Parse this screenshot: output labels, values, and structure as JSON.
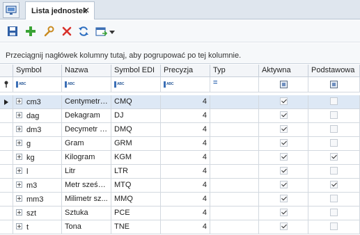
{
  "tab": {
    "title": "Lista jednostek",
    "close_glyph": "✕"
  },
  "toolbar": {
    "icons": [
      "save-icon",
      "add-icon",
      "edit-icon",
      "delete-icon",
      "refresh-icon",
      "export-icon",
      "chevron-down-icon"
    ]
  },
  "group_panel": {
    "text": "Przeciągnij nagłówek kolumny tutaj, aby pogrupować po tej kolumnie."
  },
  "grid": {
    "columns": [
      "Symbol",
      "Nazwa",
      "Symbol EDI",
      "Precyzja",
      "Typ",
      "Aktywna",
      "Podstawowa"
    ],
    "filter_abc": "ABC",
    "filter_type": "=",
    "rows": [
      {
        "symbol": "cm3",
        "nazwa": "Centymetr ...",
        "edi": "CMQ",
        "precyzja": "4",
        "typ": "",
        "aktywna": true,
        "podstawowa": false
      },
      {
        "symbol": "dag",
        "nazwa": "Dekagram",
        "edi": "DJ",
        "precyzja": "4",
        "typ": "",
        "aktywna": true,
        "podstawowa": false
      },
      {
        "symbol": "dm3",
        "nazwa": "Decymetr s...",
        "edi": "DMQ",
        "precyzja": "4",
        "typ": "",
        "aktywna": true,
        "podstawowa": false
      },
      {
        "symbol": "g",
        "nazwa": "Gram",
        "edi": "GRM",
        "precyzja": "4",
        "typ": "",
        "aktywna": true,
        "podstawowa": false
      },
      {
        "symbol": "kg",
        "nazwa": "Kilogram",
        "edi": "KGM",
        "precyzja": "4",
        "typ": "",
        "aktywna": true,
        "podstawowa": true
      },
      {
        "symbol": "l",
        "nazwa": "Litr",
        "edi": "LTR",
        "precyzja": "4",
        "typ": "",
        "aktywna": true,
        "podstawowa": false
      },
      {
        "symbol": "m3",
        "nazwa": "Metr sześci...",
        "edi": "MTQ",
        "precyzja": "4",
        "typ": "",
        "aktywna": true,
        "podstawowa": true
      },
      {
        "symbol": "mm3",
        "nazwa": "Milimetr sz...",
        "edi": "MMQ",
        "precyzja": "4",
        "typ": "",
        "aktywna": true,
        "podstawowa": false
      },
      {
        "symbol": "szt",
        "nazwa": "Sztuka",
        "edi": "PCE",
        "precyzja": "4",
        "typ": "",
        "aktywna": true,
        "podstawowa": false
      },
      {
        "symbol": "t",
        "nazwa": "Tona",
        "edi": "TNE",
        "precyzja": "4",
        "typ": "",
        "aktywna": true,
        "podstawowa": false
      }
    ],
    "selected_row": 0
  }
}
